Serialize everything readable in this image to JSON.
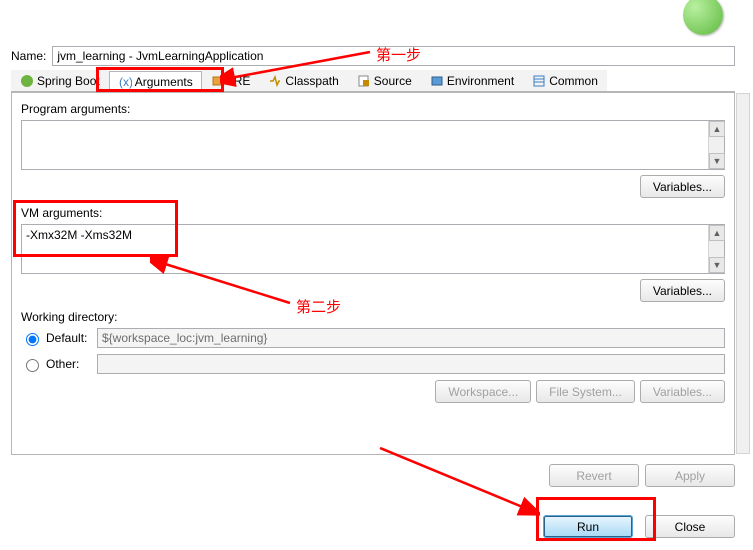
{
  "name_label": "Name:",
  "name_value": "jvm_learning - JvmLearningApplication",
  "tabs": {
    "spring": "Spring Boot",
    "arguments": "Arguments",
    "jre": "JRE",
    "classpath": "Classpath",
    "source": "Source",
    "environment": "Environment",
    "common": "Common"
  },
  "sections": {
    "program_args": "Program arguments:",
    "vm_args": "VM arguments:",
    "working_dir": "Working directory:",
    "default": "Default:",
    "other": "Other:",
    "default_path": "${workspace_loc:jvm_learning}",
    "other_path": ""
  },
  "vm_args_value": "-Xmx32M -Xms32M",
  "program_args_value": "",
  "buttons": {
    "variables": "Variables...",
    "workspace": "Workspace...",
    "filesystem": "File System...",
    "revert": "Revert",
    "apply": "Apply",
    "run": "Run",
    "close": "Close"
  },
  "annotations": {
    "step1": "第一步",
    "step2": "第二步"
  }
}
